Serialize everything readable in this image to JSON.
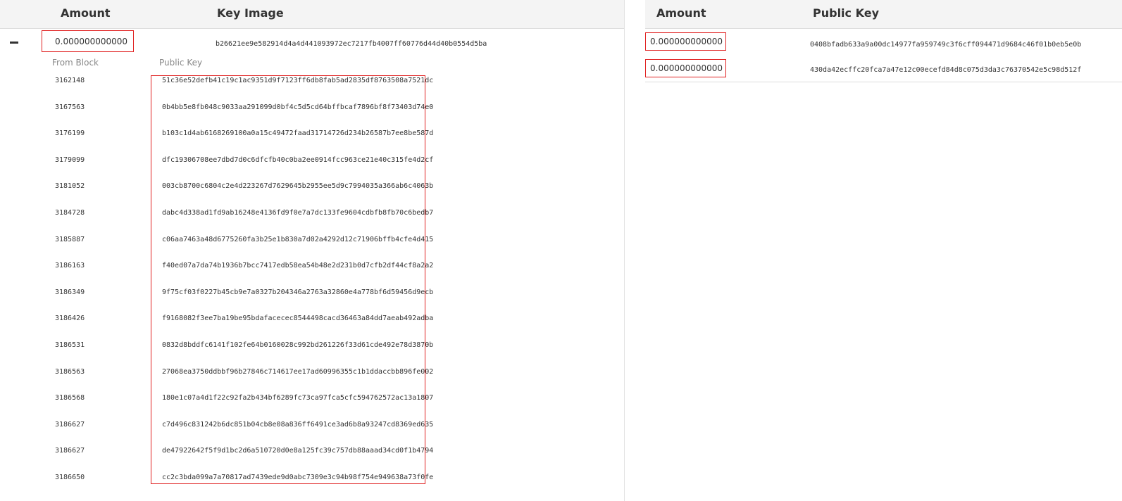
{
  "inputs": {
    "headers": {
      "amount": "Amount",
      "key_image": "Key Image"
    },
    "toggle_icon": "minus-icon",
    "input": {
      "amount": "0.000000000000",
      "key_image": "b26621ee9e582914d4a4d441093972ec7217fb4007ff60776d44d40b0554d5ba"
    },
    "ring_headers": {
      "from_block": "From Block",
      "public_key": "Public Key"
    },
    "ring": [
      {
        "block": "3162148",
        "public_key": "51c36e52defb41c19c1ac9351d9f7123ff6db8fab5ad2835df8763508a7521dc"
      },
      {
        "block": "3167563",
        "public_key": "0b4bb5e8fb048c9033aa291099d0bf4c5d5cd64bffbcaf7896bf8f73403d74e0"
      },
      {
        "block": "3176199",
        "public_key": "b103c1d4ab6168269100a0a15c49472faad31714726d234b26587b7ee8be587d"
      },
      {
        "block": "3179099",
        "public_key": "dfc19306708ee7dbd7d0c6dfcfb40c0ba2ee0914fcc963ce21e40c315fe4d2cf"
      },
      {
        "block": "3181052",
        "public_key": "003cb8700c6804c2e4d223267d7629645b2955ee5d9c7994035a366ab6c4063b"
      },
      {
        "block": "3184728",
        "public_key": "dabc4d338ad1fd9ab16248e4136fd9f0e7a7dc133fe9604cdbfb8fb70c6bedb7"
      },
      {
        "block": "3185887",
        "public_key": "c06aa7463a48d6775260fa3b25e1b830a7d02a4292d12c71906bffb4cfe4d415"
      },
      {
        "block": "3186163",
        "public_key": "f40ed07a7da74b1936b7bcc7417edb58ea54b48e2d231b0d7cfb2df44cf8a2a2"
      },
      {
        "block": "3186349",
        "public_key": "9f75cf03f0227b45cb9e7a0327b204346a2763a32860e4a778bf6d59456d9ecb"
      },
      {
        "block": "3186426",
        "public_key": "f9168082f3ee7ba19be95bdafacecec8544498cacd36463a84dd7aeab492adba"
      },
      {
        "block": "3186531",
        "public_key": "0832d8bddfc6141f102fe64b0160028c992bd261226f33d61cde492e78d3870b"
      },
      {
        "block": "3186563",
        "public_key": "27068ea3750ddbbf96b27846c714617ee17ad60996355c1b1ddaccbb896fe002"
      },
      {
        "block": "3186568",
        "public_key": "180e1c07a4d1f22c92fa2b434bf6289fc73ca97fca5cfc594762572ac13a1807"
      },
      {
        "block": "3186627",
        "public_key": "c7d496c831242b6dc851b04cb8e08a836ff6491ce3ad6b8a93247cd8369ed635"
      },
      {
        "block": "3186627",
        "public_key": "de47922642f5f9d1bc2d6a510720d0e8a125fc39c757db88aaad34cd0f1b4794"
      },
      {
        "block": "3186650",
        "public_key": "cc2c3bda099a7a70817ad7439ede9d0abc7309e3c94b98f754e949638a73f0fe"
      }
    ]
  },
  "outputs": {
    "headers": {
      "amount": "Amount",
      "public_key": "Public Key"
    },
    "rows": [
      {
        "amount": "0.000000000000",
        "public_key": "0408bfadb633a9a00dc14977fa959749c3f6cff094471d9684c46f01b0eb5e0b"
      },
      {
        "amount": "0.000000000000",
        "public_key": "430da42ecffc20fca7a47e12c00ecefd84d8c075d3da3c76370542e5c98d512f"
      }
    ]
  },
  "colors": {
    "highlight_border": "#e02020",
    "header_bg": "#f4f4f4",
    "text": "#333333",
    "muted": "#888888"
  }
}
